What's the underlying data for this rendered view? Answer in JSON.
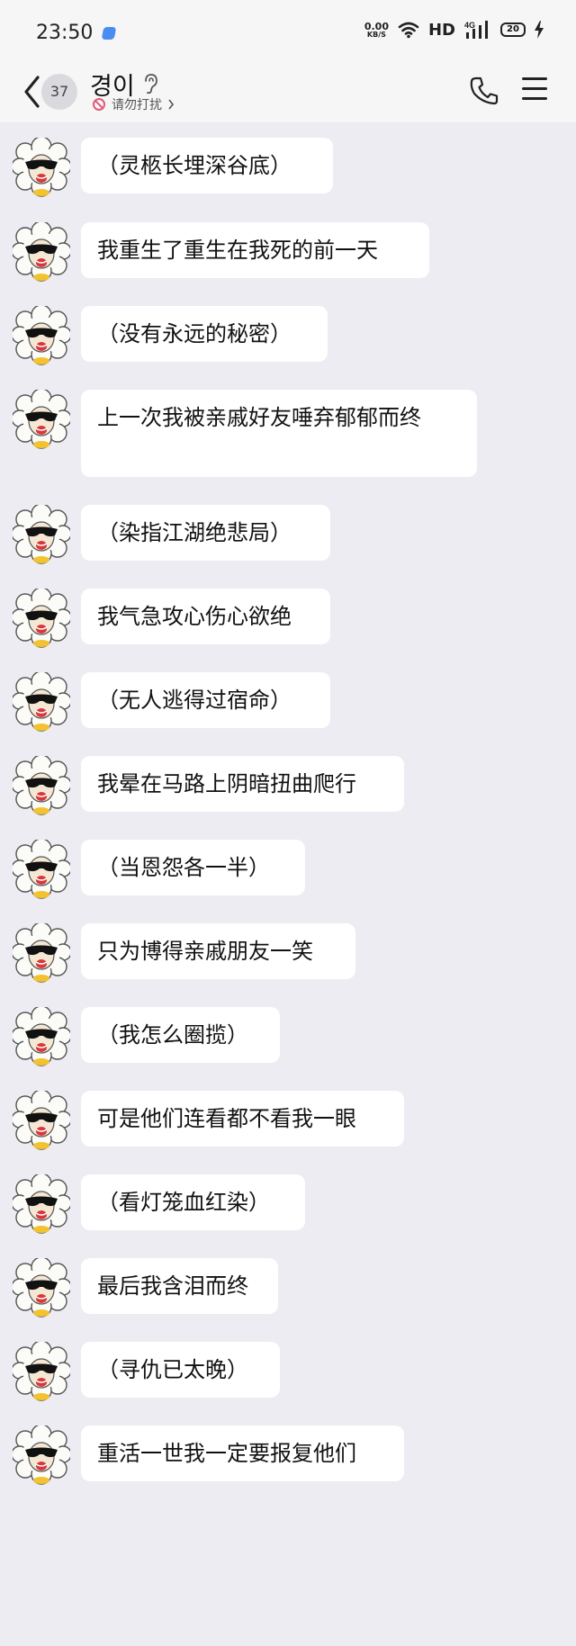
{
  "status_bar": {
    "time": "23:50",
    "net_speed_value": "0.00",
    "net_speed_unit": "KB/S",
    "hd": "HD",
    "network": "4G",
    "battery": "20"
  },
  "header": {
    "unread_count": "37",
    "contact_name": "경이",
    "dnd_label": "请勿打扰"
  },
  "messages": [
    {
      "text": "（灵柩长埋深谷底）"
    },
    {
      "text": "我重生了重生在我死的前一天"
    },
    {
      "text": "（没有永远的秘密）"
    },
    {
      "text": "上一次我被亲戚好友唾弃郁郁而终"
    },
    {
      "text": "（染指江湖绝悲局）"
    },
    {
      "text": "我气急攻心伤心欲绝"
    },
    {
      "text": "（无人逃得过宿命）"
    },
    {
      "text": "我晕在马路上阴暗扭曲爬行"
    },
    {
      "text": "（当恩怨各一半）"
    },
    {
      "text": "只为博得亲戚朋友一笑"
    },
    {
      "text": "（我怎么圈揽）"
    },
    {
      "text": "可是他们连看都不看我一眼"
    },
    {
      "text": "（看灯笼血红染）"
    },
    {
      "text": "最后我含泪而终"
    },
    {
      "text": "（寻仇已太晚）"
    },
    {
      "text": "重活一世我一定要报复他们"
    }
  ],
  "colors": {
    "chat_background": "#ececf2",
    "bubble": "#ffffff",
    "header_background": "#f6f6f6",
    "dnd_icon": "#e05a7a"
  }
}
